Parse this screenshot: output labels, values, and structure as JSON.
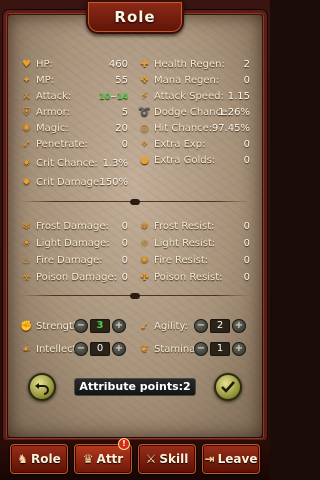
{
  "title": "Role",
  "stats_left": [
    {
      "label": "HP:",
      "value": "460",
      "icon": "heart-icon"
    },
    {
      "label": "MP:",
      "value": "55",
      "icon": "mana-icon"
    },
    {
      "label": "Attack:",
      "value": "",
      "icon": "sword-icon"
    },
    {
      "label": "Armor:",
      "value": "5",
      "icon": "shield-icon"
    },
    {
      "label": "Magic:",
      "value": "20",
      "icon": "magic-icon"
    },
    {
      "label": "Penetrate:",
      "value": "0",
      "icon": "penetrate-icon"
    },
    {
      "label": "Crit Chance:",
      "value": "1.3%",
      "icon": "crit-icon"
    },
    {
      "label": "Crit Damage:",
      "value": "150%",
      "icon": "crit-damage-icon"
    }
  ],
  "attack_value": {
    "min": "10",
    "max": "14",
    "separator": "~"
  },
  "stats_right": [
    {
      "label": "Health Regen:",
      "value": "2",
      "icon": "health-regen-icon"
    },
    {
      "label": "Mana Regen:",
      "value": "0",
      "icon": "mana-regen-icon"
    },
    {
      "label": "Attack Speed:",
      "value": "1.15",
      "icon": "attack-speed-icon"
    },
    {
      "label": "Dodge Chance:",
      "value": "1.26%",
      "icon": "dodge-icon"
    },
    {
      "label": "Hit Chance:",
      "value": "97.45%",
      "icon": "hit-icon"
    },
    {
      "label": "Extra Exp:",
      "value": "0",
      "icon": "extra-exp-icon"
    },
    {
      "label": "Extra Golds:",
      "value": "0",
      "icon": "extra-golds-icon"
    }
  ],
  "damage_left": [
    {
      "label": "Frost Damage:",
      "value": "0",
      "icon": "frost-icon"
    },
    {
      "label": "Light Damage:",
      "value": "0",
      "icon": "light-icon"
    },
    {
      "label": "Fire Damage:",
      "value": "0",
      "icon": "fire-icon"
    },
    {
      "label": "Poison Damage:",
      "value": "0",
      "icon": "poison-icon"
    }
  ],
  "damage_right": [
    {
      "label": "Frost Resist:",
      "value": "0",
      "icon": "frost-resist-icon"
    },
    {
      "label": "Light Resist:",
      "value": "0",
      "icon": "light-resist-icon"
    },
    {
      "label": "Fire Resist:",
      "value": "0",
      "icon": "fire-resist-icon"
    },
    {
      "label": "Poison Resist:",
      "value": "0",
      "icon": "poison-resist-icon"
    }
  ],
  "attributes": [
    {
      "label": "Strength:",
      "value": "3",
      "highlight": true
    },
    {
      "label": "Agility:",
      "value": "2",
      "highlight": false
    },
    {
      "label": "Intellect:",
      "value": "0",
      "highlight": false
    },
    {
      "label": "Stamina:",
      "value": "1",
      "highlight": false
    }
  ],
  "attribute_points": "Attribute points:2",
  "tabs": [
    {
      "label": "Role",
      "icon": "role-icon"
    },
    {
      "label": "Attr",
      "icon": "attr-icon"
    },
    {
      "label": "Skill",
      "icon": "skill-icon"
    },
    {
      "label": "Leave",
      "icon": "leave-icon"
    }
  ],
  "badge": "!",
  "colors": {
    "highlight": "#4cd04c",
    "accent": "#e8a030",
    "tab": "#9a2e1a"
  }
}
